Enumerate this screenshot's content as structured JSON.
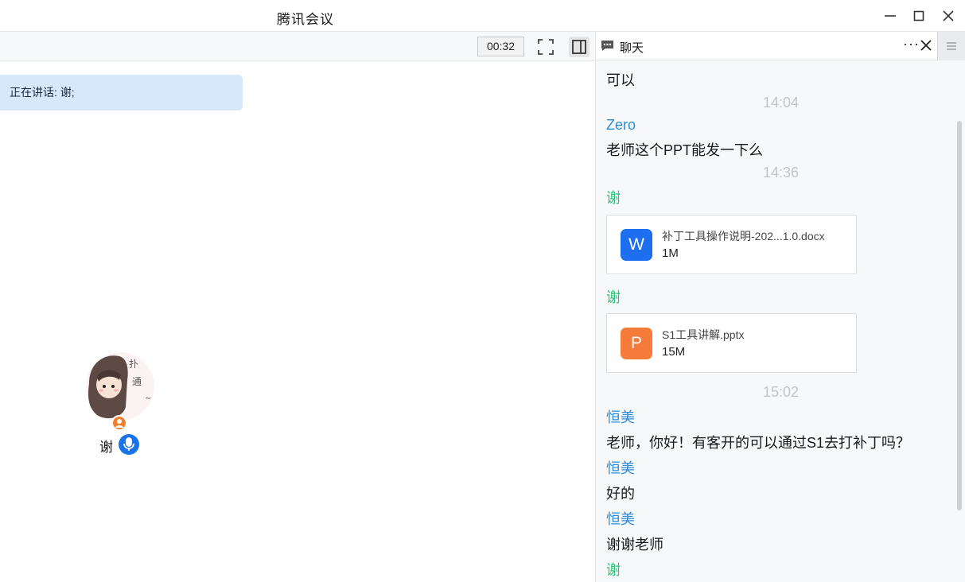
{
  "window": {
    "title": "腾讯会议",
    "minimize_icon": "minimize-icon",
    "maximize_icon": "maximize-icon",
    "close_icon": "close-icon"
  },
  "toolbar": {
    "timer": "00:32",
    "fullscreen_icon": "fullscreen-icon",
    "sidebar_toggle_icon": "sidebar-toggle-icon"
  },
  "stage": {
    "speaking_label": "正在讲话: 谢;",
    "participant": {
      "name": "谢",
      "host_badge_icon": "host-badge-icon",
      "mic_icon": "microphone-icon",
      "avatar_text": [
        "扑",
        "通",
        "~"
      ]
    }
  },
  "chat": {
    "title": "聊天",
    "more_label": "···",
    "messages": [
      {
        "type": "text",
        "text": "可以"
      },
      {
        "type": "time",
        "text": "14:04"
      },
      {
        "type": "sender",
        "text": "Zero"
      },
      {
        "type": "text",
        "text": "老师这个PPT能发一下么"
      },
      {
        "type": "time",
        "text": "14:36"
      },
      {
        "type": "sender",
        "text": "谢"
      },
      {
        "type": "file",
        "icon_letter": "W",
        "name": "补丁工具操作说明-202...1.0.docx",
        "size": "1M"
      },
      {
        "type": "sender",
        "text": "谢"
      },
      {
        "type": "file",
        "icon_letter": "P",
        "name": "S1工具讲解.pptx",
        "size": "15M"
      },
      {
        "type": "time",
        "text": "15:02"
      },
      {
        "type": "sender",
        "text": "恒美"
      },
      {
        "type": "text",
        "text": "老师，你好！有客开的可以通过S1去打补丁吗？"
      },
      {
        "type": "sender",
        "text": "恒美"
      },
      {
        "type": "text",
        "text": "好的"
      },
      {
        "type": "sender",
        "text": "恒美"
      },
      {
        "type": "text",
        "text": "谢谢老师"
      },
      {
        "type": "sender",
        "text": "谢"
      }
    ]
  },
  "colors": {
    "sender_blue": "#2b8bd8",
    "sender_green": "#2fc07a",
    "speaking_bg": "#d8e8fb",
    "word_icon": "#1e6ff0",
    "ppt_icon": "#f47b3a",
    "mic": "#1a73e8",
    "host_badge": "#f07e2b"
  }
}
